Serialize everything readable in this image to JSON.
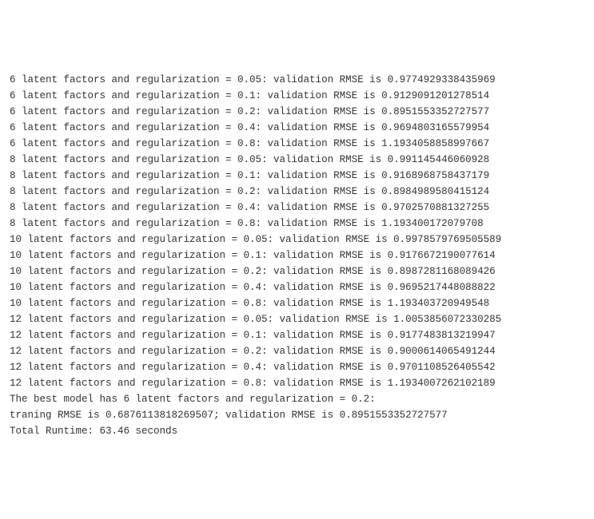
{
  "rows": [
    {
      "factors": 6,
      "reg": "0.05",
      "rmse": "0.9774929338435969"
    },
    {
      "factors": 6,
      "reg": "0.1",
      "rmse": "0.9129091201278514"
    },
    {
      "factors": 6,
      "reg": "0.2",
      "rmse": "0.8951553352727577"
    },
    {
      "factors": 6,
      "reg": "0.4",
      "rmse": "0.9694803165579954"
    },
    {
      "factors": 6,
      "reg": "0.8",
      "rmse": "1.1934058858997667"
    },
    {
      "factors": 8,
      "reg": "0.05",
      "rmse": "0.991145446060928"
    },
    {
      "factors": 8,
      "reg": "0.1",
      "rmse": "0.9168968758437179"
    },
    {
      "factors": 8,
      "reg": "0.2",
      "rmse": "0.8984989580415124"
    },
    {
      "factors": 8,
      "reg": "0.4",
      "rmse": "0.9702570881327255"
    },
    {
      "factors": 8,
      "reg": "0.8",
      "rmse": "1.193400172079708"
    },
    {
      "factors": 10,
      "reg": "0.05",
      "rmse": "0.9978579769505589"
    },
    {
      "factors": 10,
      "reg": "0.1",
      "rmse": "0.9176672190077614"
    },
    {
      "factors": 10,
      "reg": "0.2",
      "rmse": "0.8987281168089426"
    },
    {
      "factors": 10,
      "reg": "0.4",
      "rmse": "0.9695217448088822"
    },
    {
      "factors": 10,
      "reg": "0.8",
      "rmse": "1.193403720949548"
    },
    {
      "factors": 12,
      "reg": "0.05",
      "rmse": "1.0053856072330285"
    },
    {
      "factors": 12,
      "reg": "0.1",
      "rmse": "0.9177483813219947"
    },
    {
      "factors": 12,
      "reg": "0.2",
      "rmse": "0.9000614065491244"
    },
    {
      "factors": 12,
      "reg": "0.4",
      "rmse": "0.9701108526405542"
    },
    {
      "factors": 12,
      "reg": "0.8",
      "rmse": "1.1934007262102189"
    }
  ],
  "summary": {
    "best_line": "The best model has 6 latent factors and regularization = 0.2:",
    "rmse_line": "traning RMSE is 0.6876113818269507; validation RMSE is 0.8951553352727577",
    "runtime_line": "Total Runtime: 63.46 seconds"
  }
}
